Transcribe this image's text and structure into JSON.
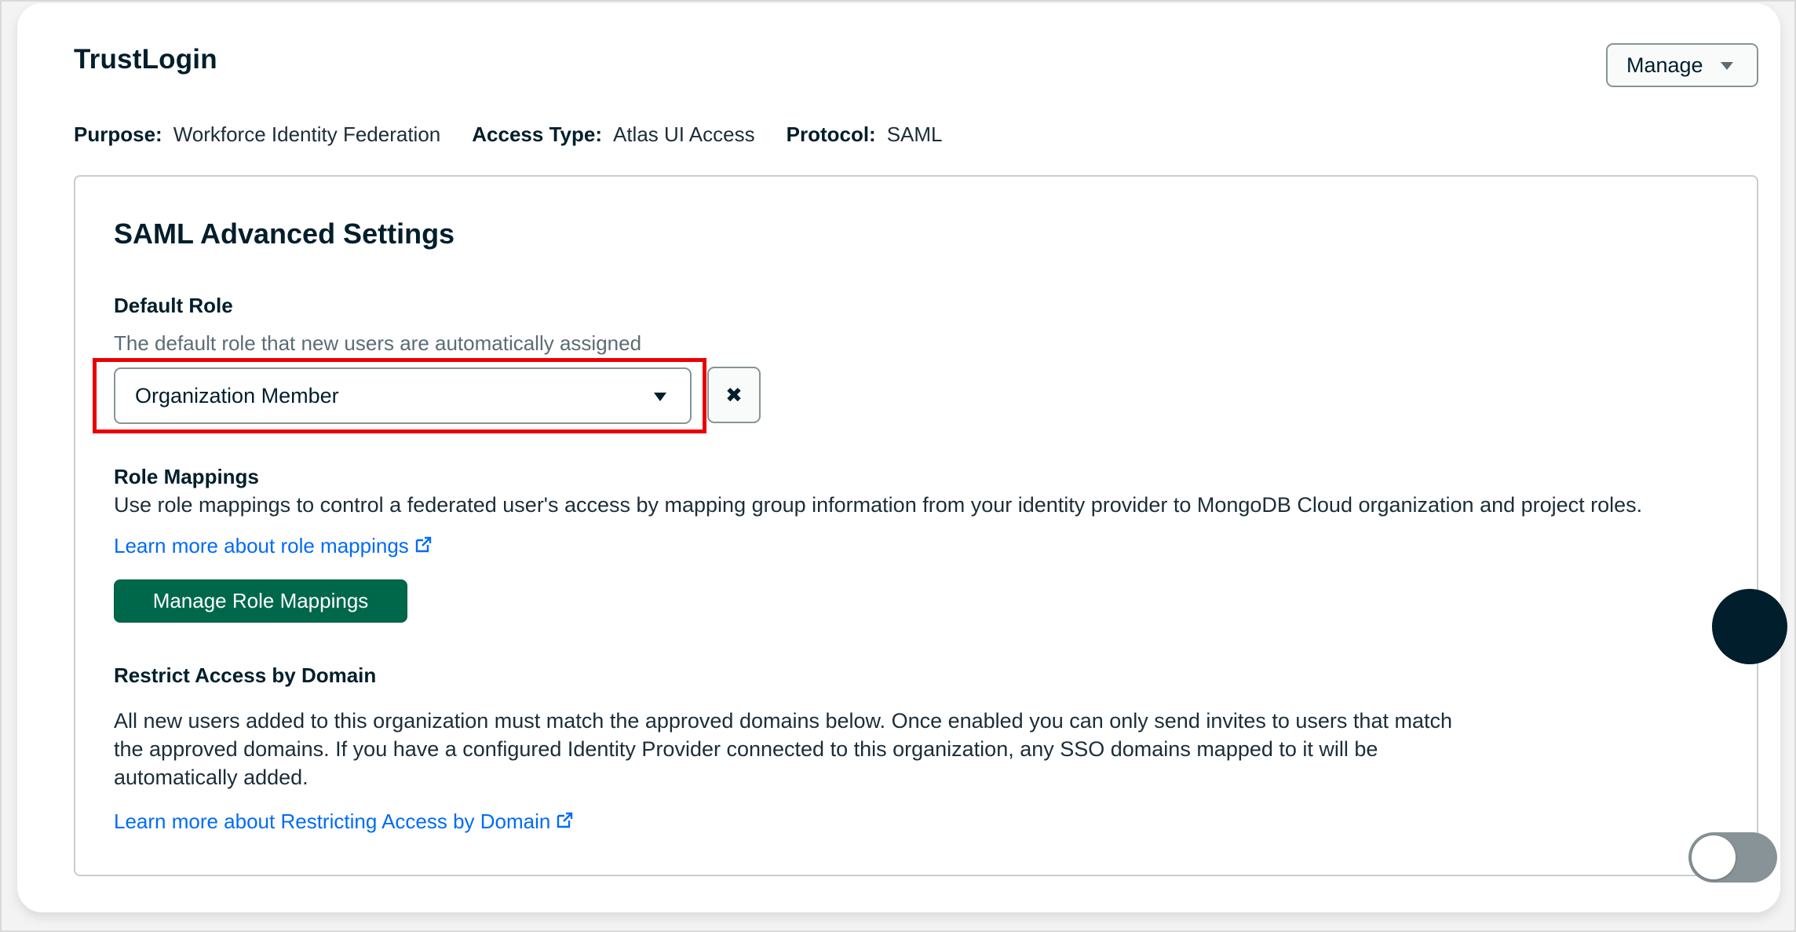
{
  "header": {
    "title": "TrustLogin",
    "manage_label": "Manage"
  },
  "meta": {
    "purpose_key": "Purpose:",
    "purpose_value": "Workforce Identity Federation",
    "access_key": "Access Type:",
    "access_value": "Atlas UI Access",
    "protocol_key": "Protocol:",
    "protocol_value": "SAML"
  },
  "settings": {
    "title": "SAML Advanced Settings",
    "default_role": {
      "label": "Default Role",
      "description": "The default role that new users are automatically assigned",
      "selected": "Organization Member",
      "clear_icon": "close-icon",
      "clear_glyph": "✖"
    },
    "role_mappings": {
      "label": "Role Mappings",
      "description": "Use role mappings to control a federated user's access by mapping group information from your identity provider to MongoDB Cloud organization and project roles.",
      "link": "Learn more about role mappings",
      "button": "Manage Role Mappings"
    },
    "restrict": {
      "label": "Restrict Access by Domain",
      "description_line1": "All new users added to this organization must match the approved domains below. Once enabled you can only send invites to users that match",
      "description_line2": "the approved domains. If you have a configured Identity Provider connected to this organization, any SSO domains mapped to it will be",
      "description_line3": "automatically added.",
      "link": "Learn more about Restricting Access by Domain",
      "toggle_on": false
    }
  },
  "colors": {
    "primary_green": "#00684a",
    "link_blue": "#016bf8",
    "highlight_red": "#ea0000",
    "toggle_off": "#889397"
  }
}
